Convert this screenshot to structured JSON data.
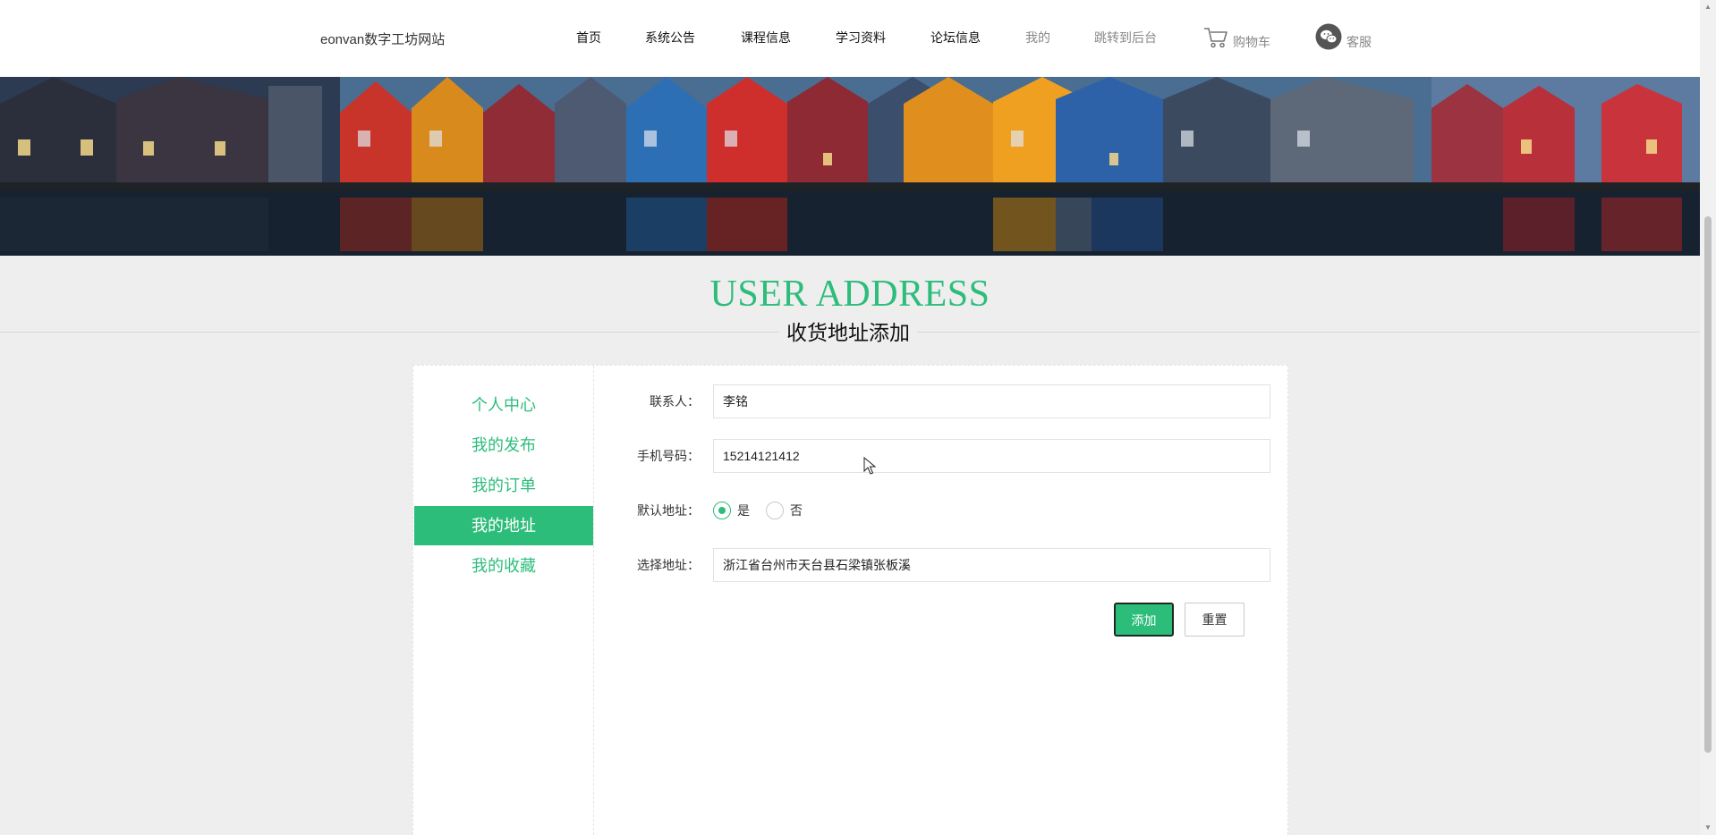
{
  "header": {
    "site_name": "eonvan数字工坊网站",
    "nav": [
      {
        "label": "首页"
      },
      {
        "label": "系统公告"
      },
      {
        "label": "课程信息"
      },
      {
        "label": "学习资料"
      },
      {
        "label": "论坛信息"
      },
      {
        "label": "我的"
      },
      {
        "label": "跳转到后台"
      }
    ],
    "cart_label": "购物车",
    "service_label": "客服"
  },
  "page": {
    "title": "USER ADDRESS",
    "subtitle": "收货地址添加"
  },
  "sidebar": {
    "items": [
      {
        "label": "个人中心"
      },
      {
        "label": "我的发布"
      },
      {
        "label": "我的订单"
      },
      {
        "label": "我的地址",
        "active": true
      },
      {
        "label": "我的收藏"
      }
    ]
  },
  "form": {
    "contact_label": "联系人：",
    "contact_value": "李铭",
    "phone_label": "手机号码：",
    "phone_value": "15214121412",
    "default_label": "默认地址：",
    "default_options": [
      {
        "label": "是",
        "checked": true
      },
      {
        "label": "否",
        "checked": false
      }
    ],
    "address_label": "选择地址：",
    "address_value": "浙江省台州市天台县石梁镇张板溪",
    "add_button": "添加",
    "reset_button": "重置"
  },
  "colors": {
    "accent": "#2dbd7b",
    "background": "#eeeeee",
    "header": "#ffffff"
  },
  "icons": [
    "cart-icon",
    "wechat-icon",
    "mouse-cursor-icon"
  ]
}
